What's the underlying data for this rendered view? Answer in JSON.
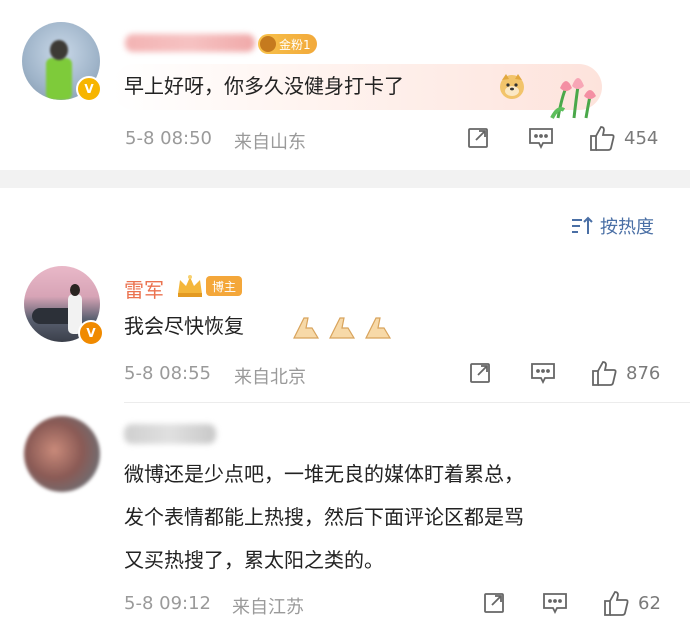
{
  "comments": [
    {
      "fan_badge": "金粉1",
      "text": "早上好呀，你多久没健身打卡了",
      "time": "5-8 08:50",
      "location": "来自山东",
      "likes": "454"
    },
    {
      "name": "雷军",
      "role_badge": "博主",
      "text": "我会尽快恢复",
      "time": "5-8 08:55",
      "location": "来自北京",
      "likes": "876"
    },
    {
      "text_lines": [
        "微博还是少点吧，一堆无良的媒体盯着累总，",
        "发个表情都能上热搜，然后下面评论区都是骂",
        "又买热搜了，累太阳之类的。"
      ],
      "time": "5-8 09:12",
      "location": "来自江苏",
      "likes": "62"
    }
  ],
  "sort": {
    "label": "按热度"
  },
  "colors": {
    "accent": "#eb7350",
    "link": "#4a6fa5",
    "vip": "#f7b500"
  },
  "icons": [
    "share-icon",
    "comment-icon",
    "like-icon",
    "doge-emoji",
    "tulip-emoji",
    "pray-hands-emoji",
    "crown-icon",
    "sort-icon"
  ]
}
